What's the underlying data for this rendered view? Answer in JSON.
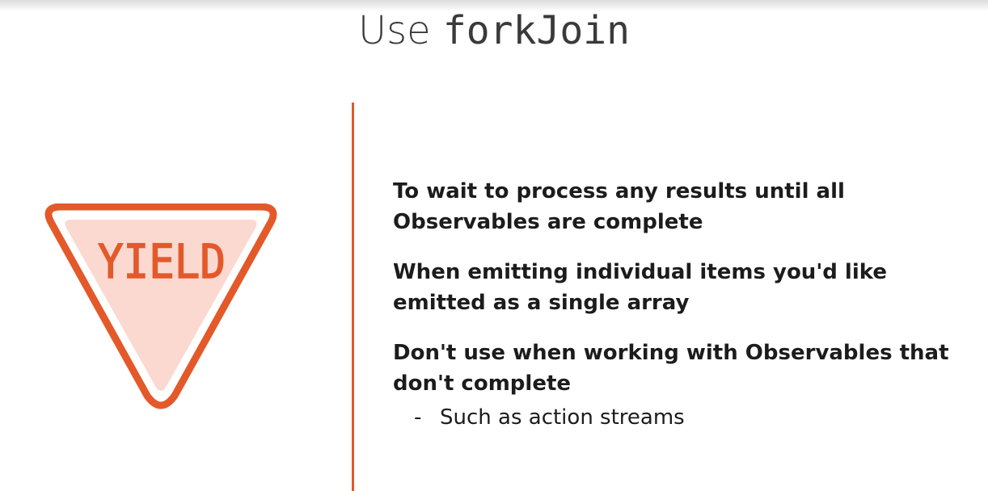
{
  "slide": {
    "title_plain": "Use ",
    "title_code": "forkJoin"
  },
  "sign": {
    "text": "YIELD",
    "colors": {
      "border": "#e4592a",
      "fill": "#fbd9d0",
      "text": "#e4592a"
    }
  },
  "bullets": [
    {
      "text": "To wait to process any results until all Observables are complete"
    },
    {
      "text": "When emitting individual items you'd like emitted as a single array"
    },
    {
      "text": "Don't use when working with Observables that don't complete"
    }
  ],
  "sub_bullets": [
    {
      "dash": "-",
      "text": "Such as action streams"
    }
  ],
  "colors": {
    "accent": "#e4592a",
    "background": "#ffffff",
    "text": "#1c1c1c"
  }
}
